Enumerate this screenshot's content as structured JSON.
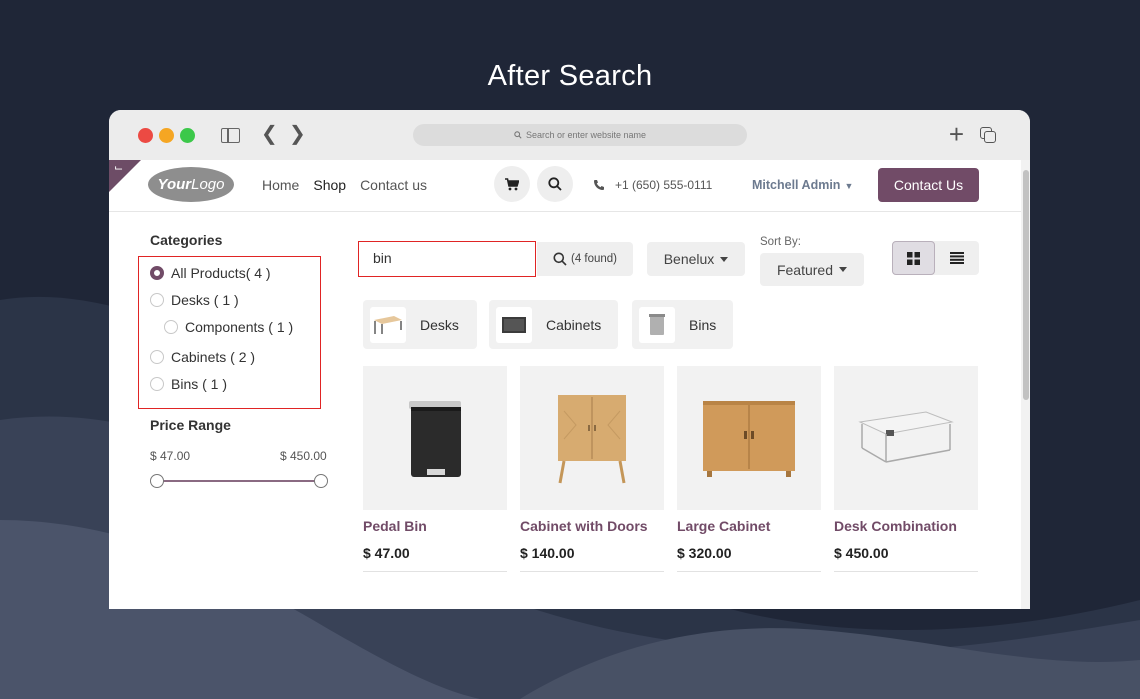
{
  "page_heading": "After Search",
  "browser": {
    "address_placeholder": "Search or enter website name",
    "new_tab_glyph": "+"
  },
  "header": {
    "logo_prefix": "Your",
    "logo_suffix": "Logo",
    "nav": [
      "Home",
      "Shop",
      "Contact us"
    ],
    "active_nav": "Shop",
    "phone": "+1 (650) 555-0111",
    "user_name": "Mitchell Admin",
    "contact_button": "Contact Us"
  },
  "sidebar": {
    "categories_title": "Categories",
    "categories": [
      {
        "label": "All Products( 4 )",
        "checked": true
      },
      {
        "label": "Desks ( 1 )",
        "checked": false
      },
      {
        "label": "Components ( 1 )",
        "checked": false
      },
      {
        "label": "Cabinets ( 2 )",
        "checked": false
      },
      {
        "label": "Bins ( 1 )",
        "checked": false
      }
    ],
    "price_title": "Price Range",
    "price_min": "$ 47.00",
    "price_max": "$ 450.00"
  },
  "toolbar": {
    "search_value": "bin",
    "found_count": "(4 found)",
    "pricelist": "Benelux",
    "sort_label": "Sort By:",
    "sort_value": "Featured"
  },
  "chips": [
    "Desks",
    "Cabinets",
    "Bins"
  ],
  "products": [
    {
      "name": "Pedal Bin",
      "price": "$ 47.00"
    },
    {
      "name": "Cabinet with Doors",
      "price": "$ 140.00"
    },
    {
      "name": "Large Cabinet",
      "price": "$ 320.00"
    },
    {
      "name": "Desk Combination",
      "price": "$ 450.00"
    }
  ],
  "colors": {
    "brand": "#714b67",
    "highlight_border": "#e02424",
    "background": "#1f2637"
  }
}
